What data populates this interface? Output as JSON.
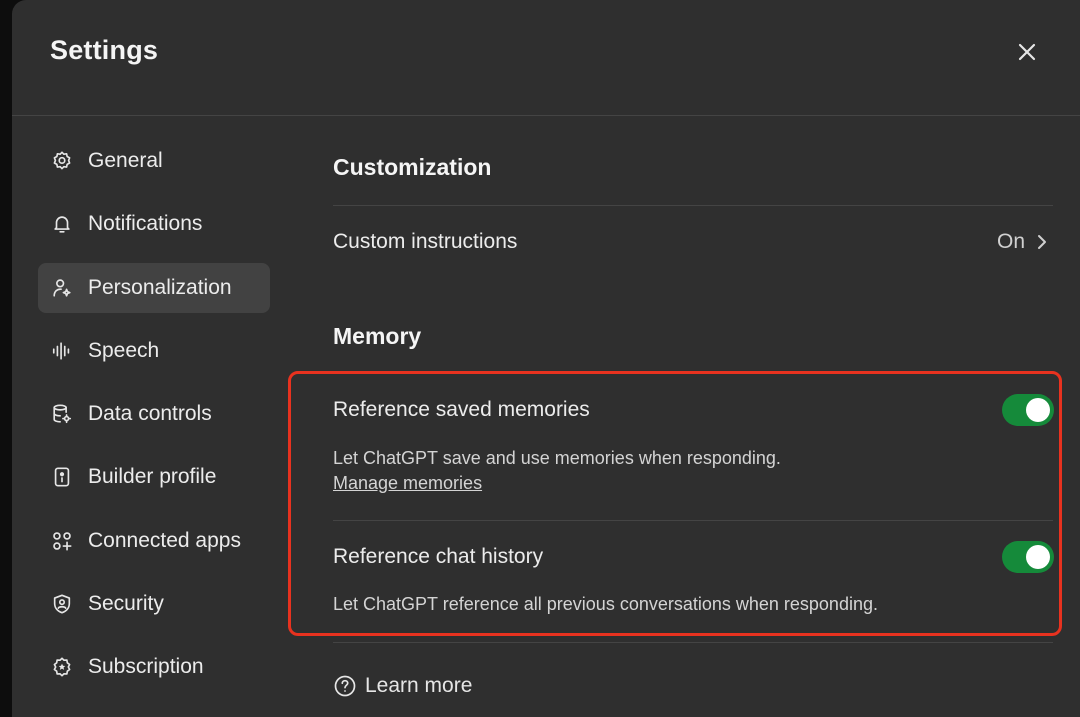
{
  "window": {
    "title": "Settings"
  },
  "sidebar": {
    "items": [
      {
        "label": "General",
        "icon": "gear-icon",
        "active": false
      },
      {
        "label": "Notifications",
        "icon": "bell-icon",
        "active": false
      },
      {
        "label": "Personalization",
        "icon": "person-sparkle-icon",
        "active": true
      },
      {
        "label": "Speech",
        "icon": "waveform-icon",
        "active": false
      },
      {
        "label": "Data controls",
        "icon": "database-gear-icon",
        "active": false
      },
      {
        "label": "Builder profile",
        "icon": "id-badge-icon",
        "active": false
      },
      {
        "label": "Connected apps",
        "icon": "apps-grid-icon",
        "active": false
      },
      {
        "label": "Security",
        "icon": "shield-icon",
        "active": false
      },
      {
        "label": "Subscription",
        "icon": "badge-star-icon",
        "active": false
      }
    ]
  },
  "content": {
    "customization": {
      "title": "Customization",
      "custom_instructions": {
        "label": "Custom instructions",
        "value": "On"
      }
    },
    "memory": {
      "title": "Memory",
      "saved_memories": {
        "label": "Reference saved memories",
        "description": "Let ChatGPT save and use memories when responding.",
        "link": "Manage memories",
        "enabled": true
      },
      "chat_history": {
        "label": "Reference chat history",
        "description": "Let ChatGPT reference all previous conversations when responding.",
        "enabled": true
      }
    },
    "learn_more": "Learn more"
  },
  "colors": {
    "background": "#2f2f2f",
    "toggle_on": "#158a3a",
    "highlight": "#e8321f",
    "active_item": "#424242"
  }
}
